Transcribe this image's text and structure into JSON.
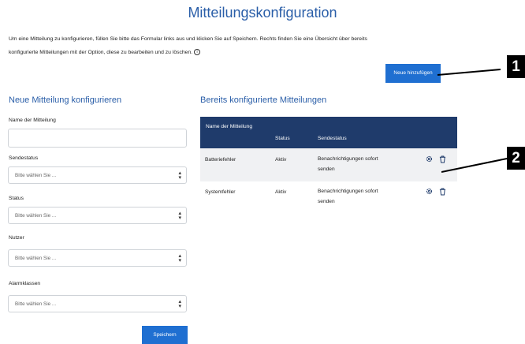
{
  "page": {
    "title": "Mitteilungskonfiguration",
    "intro_line1": "Um eine Mitteilung zu konfigurieren, füllen Sie bitte das Formular links aus und klicken Sie auf Speichern. Rechts finden Sie eine Übersicht über bereits",
    "intro_line2": "konfigurierte Mitteilungen mit der Option, diese zu bearbeiten und zu löschen.",
    "info_icon": "info-icon"
  },
  "toolbar": {
    "add_label": "Neue hinzufügen"
  },
  "callouts": [
    "1",
    "2"
  ],
  "form": {
    "title": "Neue Mitteilung konfigurieren",
    "name_label": "Name der Mitteilung",
    "name_value": "",
    "fields": [
      {
        "label": "Sendestatus",
        "placeholder": "Bitte wählen Sie ..."
      },
      {
        "label": "Status",
        "placeholder": "Bitte wählen Sie ..."
      },
      {
        "label": "Nutzer",
        "placeholder": "Bitte wählen Sie ..."
      },
      {
        "label": "Alarmklassen",
        "placeholder": "Bitte wählen Sie ..."
      }
    ],
    "save_label": "Speichern"
  },
  "table": {
    "title": "Bereits konfigurierte Mitteilungen",
    "headers": {
      "name": "Name der Mitteilung",
      "status": "Status",
      "send": "Sendestatus"
    },
    "rows": [
      {
        "name": "Batteriefehler",
        "status": "Aktiv",
        "send_line1": "Benachrichtigungen sofort",
        "send_line2": "senden"
      },
      {
        "name": "Systemfehler",
        "status": "Aktiv",
        "send_line1": "Benachrichtigungen sofort",
        "send_line2": "senden"
      }
    ],
    "row_icons": [
      "gear-icon",
      "trash-icon"
    ]
  },
  "colors": {
    "accent": "#1f6fd1",
    "heading": "#2a5ea8",
    "table_header": "#1f3b6b",
    "row_alt": "#f0f1f3",
    "callout": "#000000"
  }
}
